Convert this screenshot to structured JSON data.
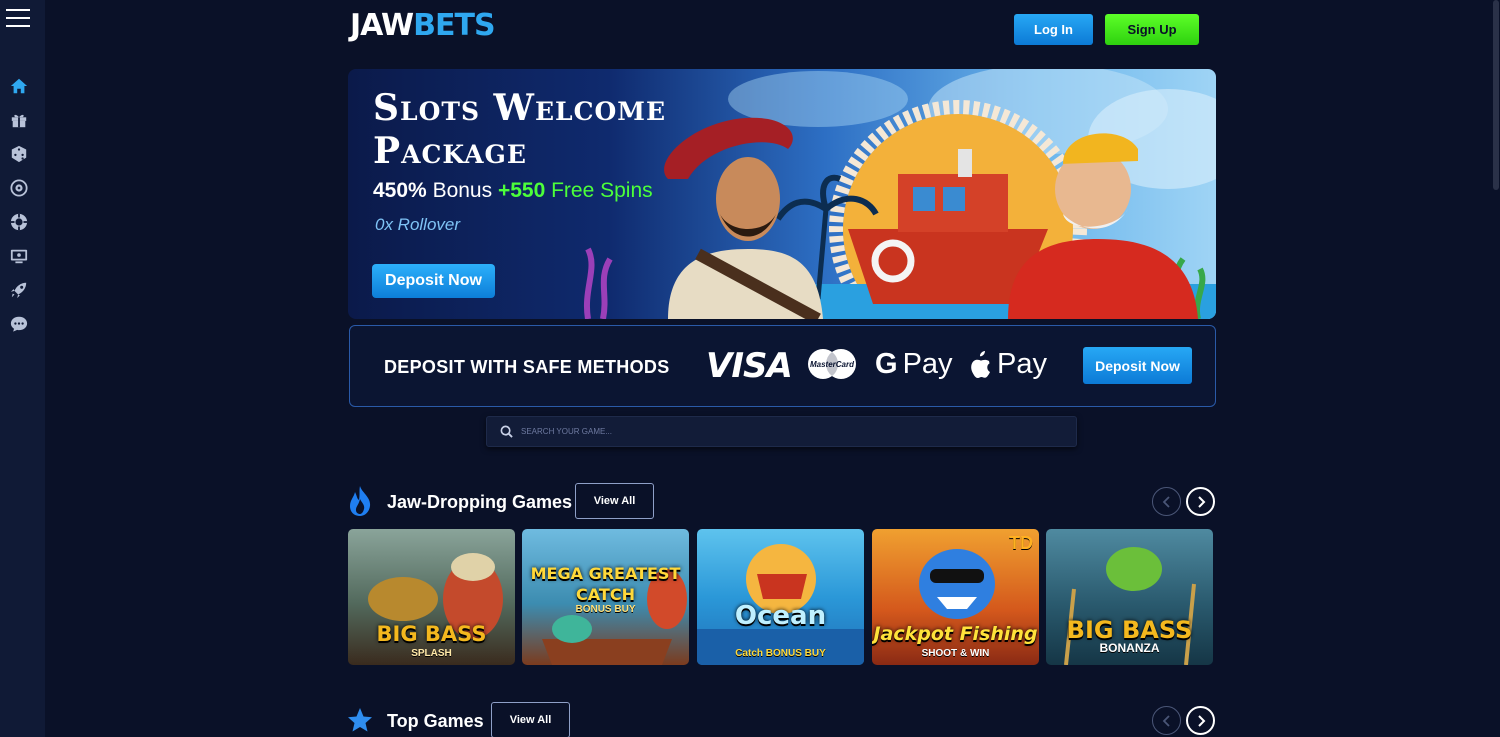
{
  "header": {
    "logo_part1": "JAW",
    "logo_part2": "BETS",
    "login_label": "Log In",
    "signup_label": "Sign Up"
  },
  "sidebar": {
    "items": [
      {
        "icon": "home-icon"
      },
      {
        "icon": "gift-icon"
      },
      {
        "icon": "dice-icon"
      },
      {
        "icon": "roulette-icon"
      },
      {
        "icon": "poker-chip-icon"
      },
      {
        "icon": "live-casino-icon"
      },
      {
        "icon": "rocket-icon"
      },
      {
        "icon": "chat-icon"
      }
    ]
  },
  "banner": {
    "title_line1": "Slots Welcome",
    "title_line2": "Package",
    "bonus_percent": "450%",
    "bonus_word": "Bonus",
    "spins_count": "+550",
    "spins_word": "Free Spins",
    "rollover": "0x Rollover",
    "deposit_label": "Deposit Now"
  },
  "methods": {
    "label": "DEPOSIT WITH SAFE METHODS",
    "visa": "VISA",
    "mastercard": "MasterCard",
    "gpay_g": "G",
    "gpay_text": "Pay",
    "applepay_text": "Pay",
    "deposit_label": "Deposit Now"
  },
  "search": {
    "placeholder": "SEARCH YOUR GAME..."
  },
  "sections": [
    {
      "title": "Jaw-Dropping Games",
      "view_all": "View All",
      "games": [
        {
          "name": "BIG BASS",
          "sub": "SPLASH",
          "bg": "#6a7e6c"
        },
        {
          "name": "MEGA GREATEST CATCH",
          "sub": "BONUS BUY",
          "bg": "#3f8fb3"
        },
        {
          "name": "Ocean",
          "sub": "Catch BONUS BUY",
          "bg": "#2b98d8"
        },
        {
          "name": "Jackpot Fishing",
          "sub": "SHOOT & WIN",
          "bg": "#d4581c",
          "badge": "TD"
        },
        {
          "name": "BIG BASS",
          "sub": "BONANZA",
          "bg": "#2a5a6e"
        }
      ]
    },
    {
      "title": "Top Games",
      "view_all": "View All"
    }
  ],
  "colors": {
    "background": "#0a1128",
    "accent_blue": "#27a8f5",
    "accent_green": "#4cff3a"
  }
}
